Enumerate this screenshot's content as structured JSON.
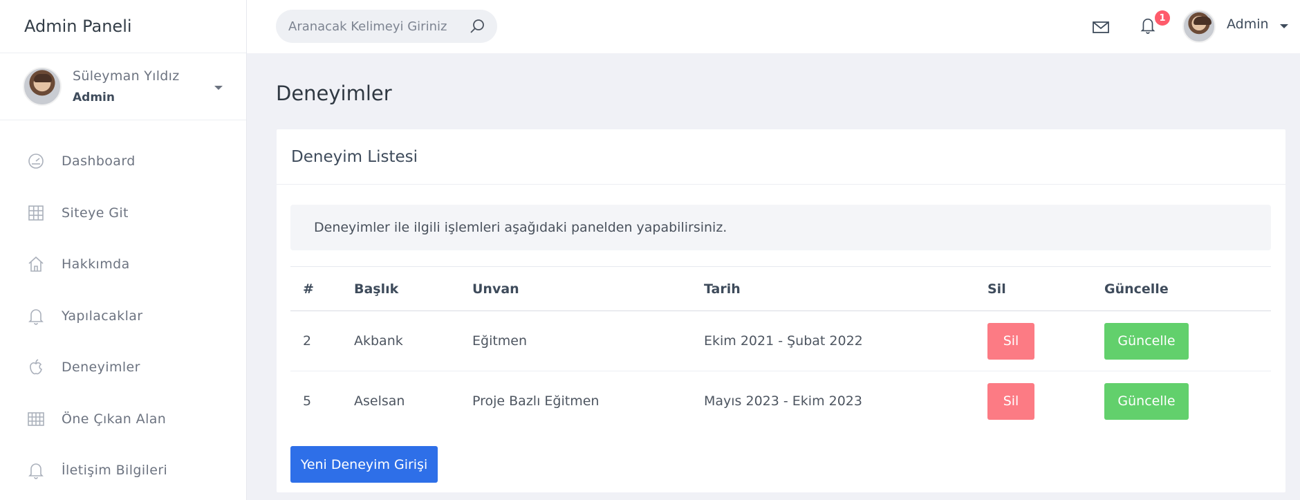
{
  "sidebar": {
    "brand": "Admin Paneli",
    "profile": {
      "name": "Süleyman Yıldız",
      "role": "Admin"
    },
    "items": [
      {
        "label": "Dashboard",
        "icon": "speedometer-icon"
      },
      {
        "label": "Siteye Git",
        "icon": "grid-icon"
      },
      {
        "label": "Hakkımda",
        "icon": "home-icon"
      },
      {
        "label": "Yapılacaklar",
        "icon": "bell-icon"
      },
      {
        "label": "Deneyimler",
        "icon": "apple-icon"
      },
      {
        "label": "Öne Çıkan Alan",
        "icon": "table-grid-icon"
      },
      {
        "label": "İletişim Bilgileri",
        "icon": "bell-icon"
      }
    ]
  },
  "topbar": {
    "search_placeholder": "Aranacak Kelimeyi Giriniz",
    "notification_count": "1",
    "user": "Admin"
  },
  "main": {
    "page_title": "Deneyimler",
    "card_title": "Deneyim Listesi",
    "info": "Deneyimler ile ilgili işlemleri aşağıdaki panelden yapabilirsiniz.",
    "columns": [
      "#",
      "Başlık",
      "Unvan",
      "Tarih",
      "Sil",
      "Güncelle"
    ],
    "rows": [
      {
        "id": "2",
        "title": "Akbank",
        "role": "Eğitmen",
        "date": "Ekim 2021 - Şubat 2022",
        "delete": "Sil",
        "update": "Güncelle"
      },
      {
        "id": "5",
        "title": "Aselsan",
        "role": "Proje Bazlı Eğitmen",
        "date": "Mayıs 2023 - Ekim 2023",
        "delete": "Sil",
        "update": "Güncelle"
      }
    ],
    "new_button": "Yeni Deneyim Girişi"
  },
  "colors": {
    "primary": "#2e6fe8",
    "danger": "#fc7b84",
    "success": "#62d06c",
    "badge": "#fe5b6b"
  }
}
